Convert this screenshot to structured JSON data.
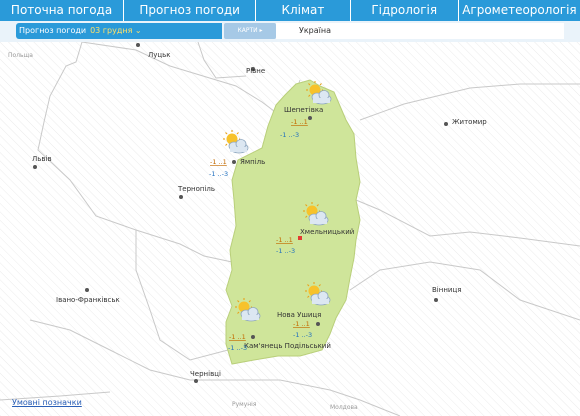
{
  "nav": {
    "items": [
      "Поточна погода",
      "Прогноз погоди",
      "Клімат",
      "Гідрологія",
      "Агрометеорологія"
    ]
  },
  "subbar": {
    "forecast_label": "Прогноз погоди",
    "date": "03 грудня",
    "maps_button": "КАРТИ",
    "region": "Україна"
  },
  "map": {
    "country_labels": [
      "Польща",
      "Румунія",
      "Молдова"
    ],
    "cities": [
      "Луцьк",
      "Рівне",
      "Житомир",
      "Львів",
      "Тернопіль",
      "Івано-Франківськ",
      "Вінниця",
      "Чернівці",
      "Шепетівка",
      "Ямпіль",
      "Хмельницький",
      "Нова Ушиця",
      "Кам'янець Подільський"
    ],
    "weather_points": [
      {
        "station": "Шепетівка",
        "day_temp": "-1 ..1",
        "night_temp": "-1 ..-3",
        "icon": "partly-cloudy-icon"
      },
      {
        "station": "Ямпіль",
        "day_temp": "-1 ..1",
        "night_temp": "-1 ..-3",
        "icon": "partly-cloudy-icon"
      },
      {
        "station": "Хмельницький",
        "day_temp": "-1 ..1",
        "night_temp": "-1 ..-3",
        "icon": "partly-cloudy-icon"
      },
      {
        "station": "Нова Ушиця",
        "day_temp": "-1 ..1",
        "night_temp": "-1 ..-3",
        "icon": "partly-cloudy-icon"
      },
      {
        "station": "Кам'янець Подільський",
        "day_temp": "-1 ..1",
        "night_temp": "-1 ..-3",
        "icon": "partly-cloudy-icon"
      }
    ]
  },
  "footer": {
    "legend_link": "Умовні позначки"
  },
  "colors": {
    "nav_bg": "#2a9ad9",
    "region_fill": "#cfe59a",
    "day_temp": "#c36a00",
    "night_temp": "#1f6fbf",
    "capital_marker": "#e23b30"
  }
}
